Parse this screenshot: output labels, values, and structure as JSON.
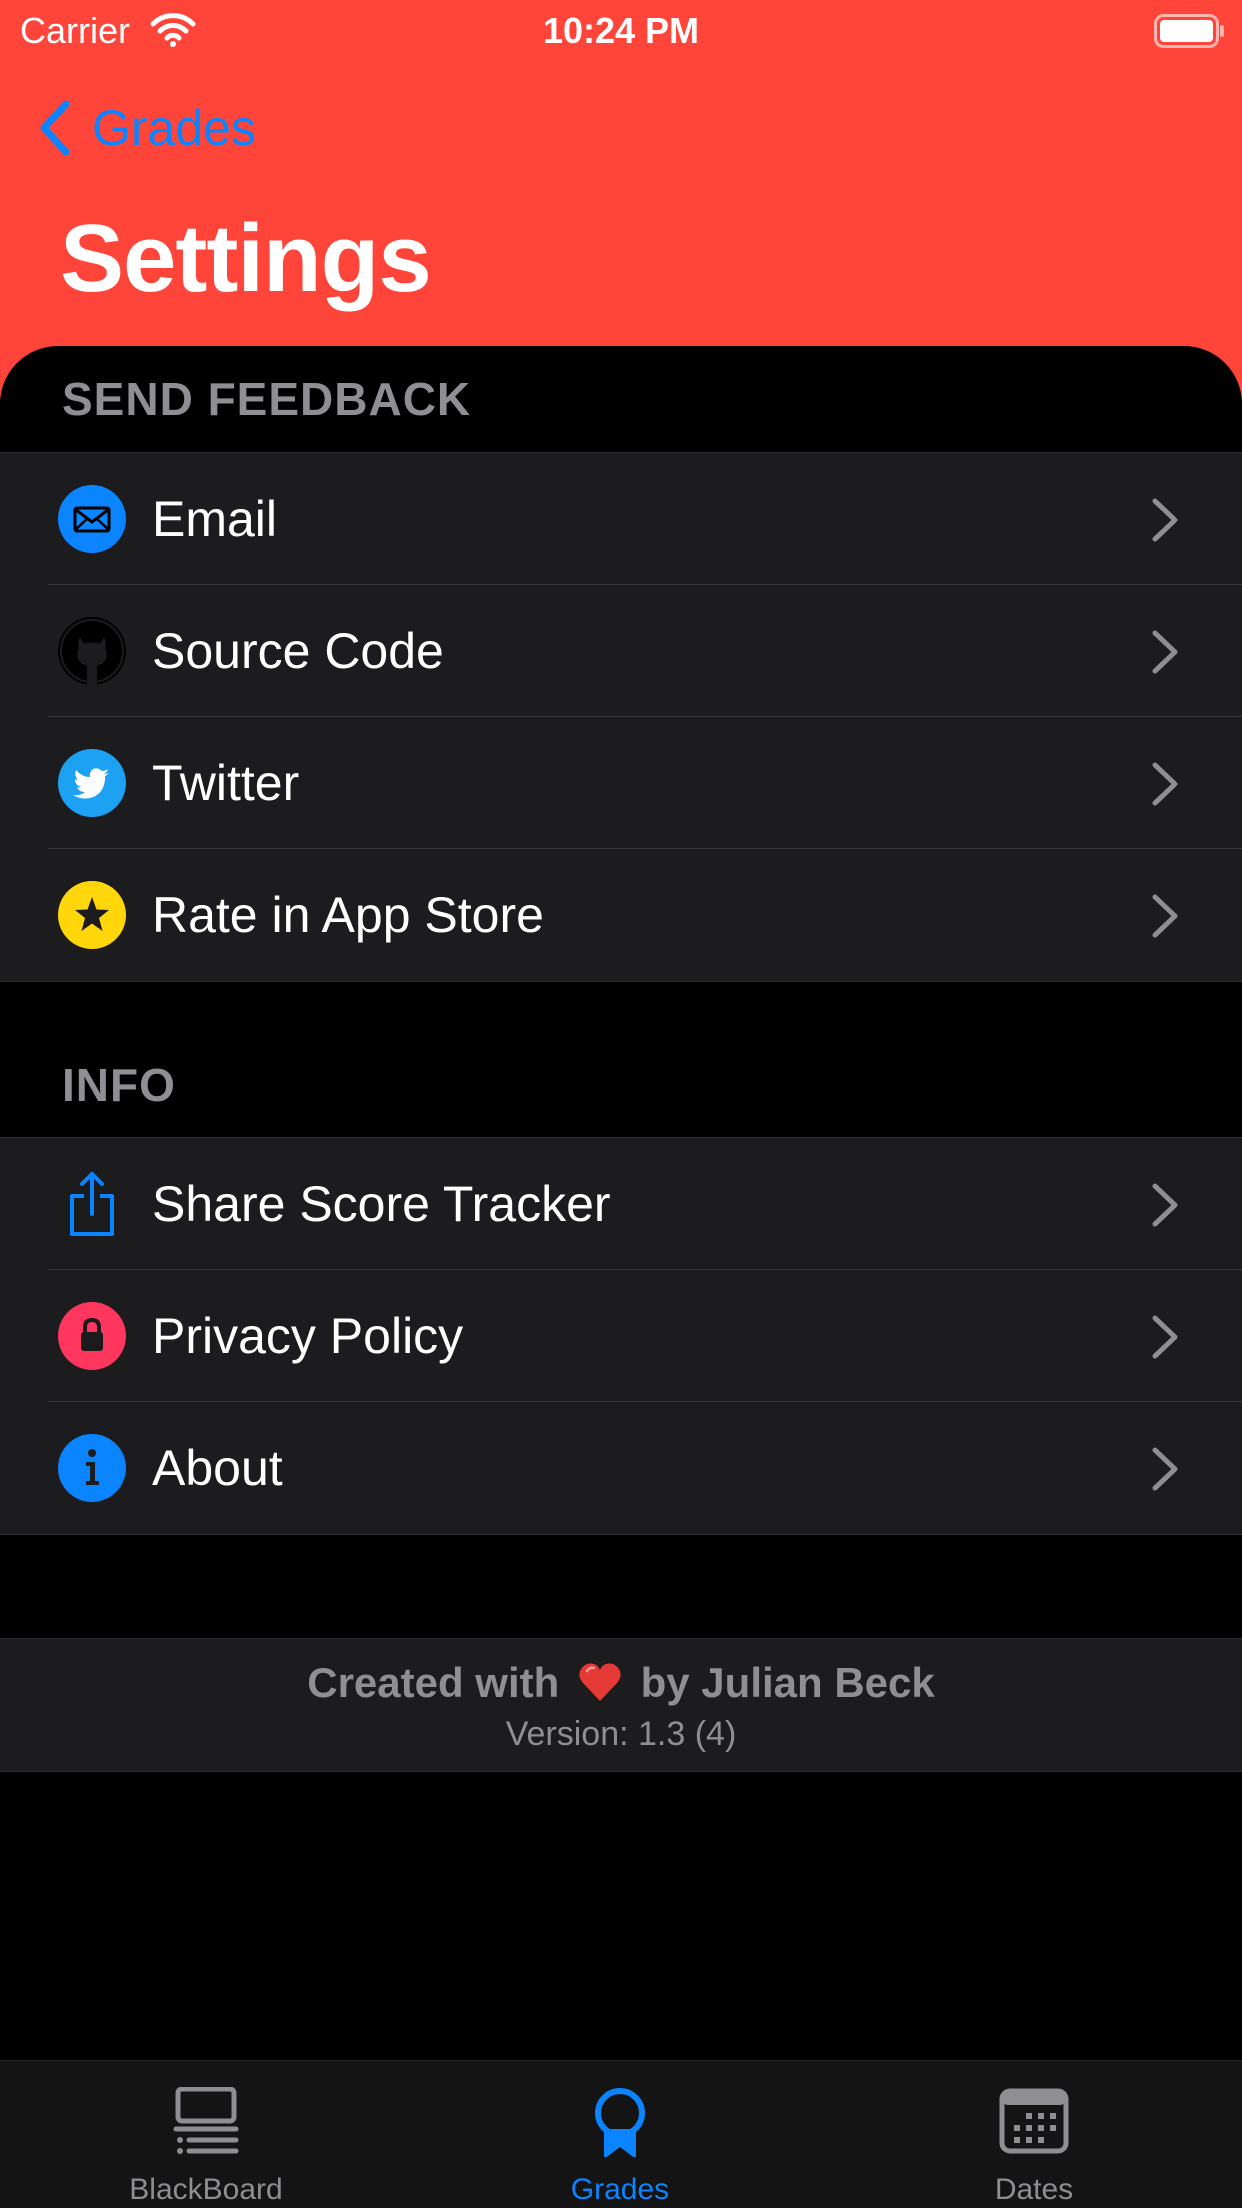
{
  "status_bar": {
    "carrier": "Carrier",
    "time": "10:24 PM"
  },
  "nav": {
    "back_label": "Grades",
    "title": "Settings"
  },
  "sections": [
    {
      "header": "SEND FEEDBACK",
      "items": [
        {
          "label": "Email",
          "icon": "envelope-icon",
          "icon_color": "#0A84FF"
        },
        {
          "label": "Source Code",
          "icon": "github-icon",
          "icon_color": "#000000"
        },
        {
          "label": "Twitter",
          "icon": "twitter-icon",
          "icon_color": "#1DA1F2"
        },
        {
          "label": "Rate in App Store",
          "icon": "star-icon",
          "icon_color": "#FFD60A"
        }
      ]
    },
    {
      "header": "INFO",
      "items": [
        {
          "label": "Share Score Tracker",
          "icon": "share-icon",
          "icon_color": "#0A84FF"
        },
        {
          "label": "Privacy Policy",
          "icon": "lock-icon",
          "icon_color": "#FF375F"
        },
        {
          "label": "About",
          "icon": "info-icon",
          "icon_color": "#0A84FF"
        }
      ]
    }
  ],
  "footer": {
    "credit_prefix": "Created with",
    "credit_suffix": "by Julian Beck",
    "version": "Version: 1.3 (4)"
  },
  "tabbar": {
    "tabs": [
      {
        "label": "BlackBoard",
        "icon": "blackboard-icon",
        "selected": false
      },
      {
        "label": "Grades",
        "icon": "award-ribbon-icon",
        "selected": true
      },
      {
        "label": "Dates",
        "icon": "calendar-icon",
        "selected": false
      }
    ]
  },
  "colors": {
    "header_bg": "#FF453A",
    "accent": "#0A84FF",
    "cell_bg": "#1C1C1E",
    "secondary_text": "#8E8E93"
  }
}
